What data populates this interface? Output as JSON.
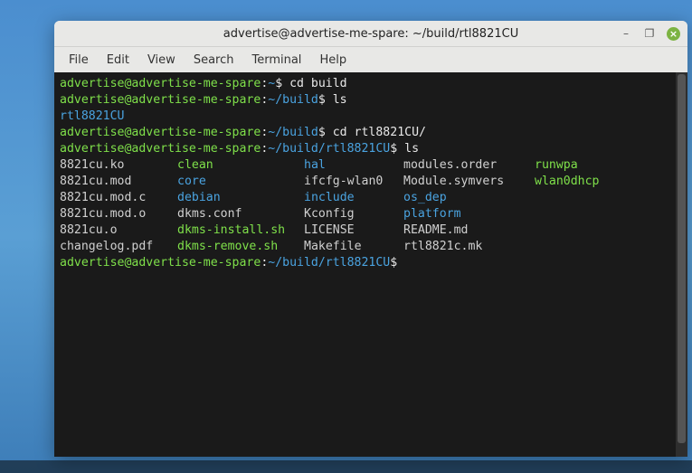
{
  "window": {
    "title": "advertise@advertise-me-spare: ~/build/rtl8821CU"
  },
  "menu": {
    "file": "File",
    "edit": "Edit",
    "view": "View",
    "search": "Search",
    "terminal": "Terminal",
    "help": "Help"
  },
  "colors": {
    "prompt_user": "#7fe04a",
    "prompt_path": "#4aa3e0",
    "dir": "#4aa3e0",
    "exec": "#7fe04a",
    "fg": "#d0d0d0",
    "bg": "#1a1a1a"
  },
  "lines": {
    "l1_user": "advertise@advertise-me-spare",
    "l1_sep": ":",
    "l1_path": "~",
    "l1_dollar": "$ ",
    "l1_cmd": "cd build",
    "l2_user": "advertise@advertise-me-spare",
    "l2_path": "~/build",
    "l2_cmd": "ls",
    "l3_out": "rtl8821CU",
    "l4_user": "advertise@advertise-me-spare",
    "l4_path": "~/build",
    "l4_cmd": "cd rtl8821CU/",
    "l5_user": "advertise@advertise-me-spare",
    "l5_path": "~/build/rtl8821CU",
    "l5_cmd": "ls",
    "ls": {
      "r1": {
        "c1": "8821cu.ko",
        "c2": "clean",
        "c3": "hal",
        "c4": "modules.order",
        "c5": "runwpa"
      },
      "r2": {
        "c1": "8821cu.mod",
        "c2": "core",
        "c3": "ifcfg-wlan0",
        "c4": "Module.symvers",
        "c5": "wlan0dhcp"
      },
      "r3": {
        "c1": "8821cu.mod.c",
        "c2": "debian",
        "c3": "include",
        "c4": "os_dep",
        "c5": ""
      },
      "r4": {
        "c1": "8821cu.mod.o",
        "c2": "dkms.conf",
        "c3": "Kconfig",
        "c4": "platform",
        "c5": ""
      },
      "r5": {
        "c1": "8821cu.o",
        "c2": "dkms-install.sh",
        "c3": "LICENSE",
        "c4": "README.md",
        "c5": ""
      },
      "r6": {
        "c1": "changelog.pdf",
        "c2": "dkms-remove.sh",
        "c3": "Makefile",
        "c4": "rtl8821c.mk",
        "c5": ""
      }
    },
    "l12_user": "advertise@advertise-me-spare",
    "l12_path": "~/build/rtl8821CU",
    "l12_cmd": ""
  },
  "win_buttons": {
    "minimize": "–",
    "maximize": "❐",
    "close": "×"
  }
}
